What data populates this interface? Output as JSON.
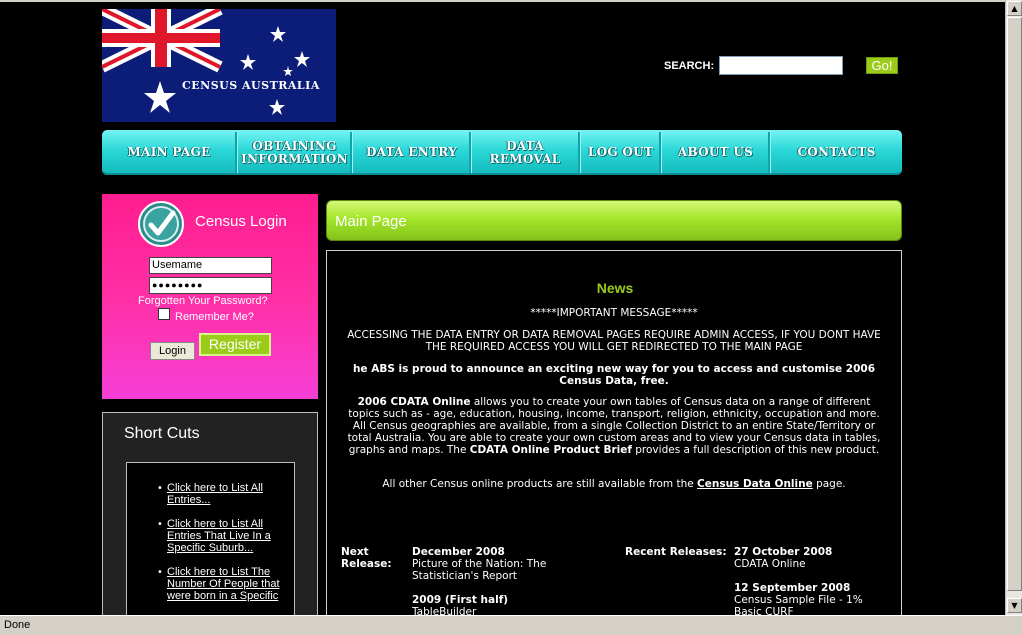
{
  "logo": {
    "text": "CENSUS AUSTRALIA"
  },
  "search": {
    "label": "SEARCH:",
    "value": "",
    "button": "Go!"
  },
  "nav": {
    "items": [
      "MAIN PAGE",
      "OBTAINING INFORMATION",
      "DATA ENTRY",
      "DATA REMOVAL",
      "LOG OUT",
      "ABOUT US",
      "CONTACTS"
    ]
  },
  "login": {
    "title": "Census Login",
    "username_value": "Usemame",
    "password_value": "●●●●●●●●",
    "forgot": "Forgotten Your Password?",
    "remember": "Remember Me?",
    "login_button": "Login",
    "register_button": "Register"
  },
  "shortcuts": {
    "title": "Short Cuts",
    "items": [
      "Click here to List All Entries...",
      "Click here to List All Entries That Live In a Specific Suburb...",
      "Click here to List The Number Of People that were born in a Specific"
    ]
  },
  "main": {
    "header": "Main Page",
    "news_title": "News",
    "important": "*****IMPORTANT MESSAGE*****",
    "admin_notice": "ACCESSING THE DATA ENTRY OR DATA REMOVAL PAGES REQUIRE ADMIN ACCESS, IF YOU DONT HAVE THE REQUIRED ACCESS YOU WILL GET REDIRECTED TO THE MAIN PAGE",
    "announce": "he ABS is proud to announce an exciting new way for you to access and customise 2006 Census Data, free.",
    "cdata_name": "2006 CDATA Online",
    "cdata_text": " allows you to create your own tables of Census data on a range of different topics such as - age, education, housing, income, transport, religion, ethnicity, occupation and more. All Census geographies are available, from a single Collection District to an entire State/Territory or total Australia. You are able to create your own custom areas and to view your Census data in tables, graphs and maps. The ",
    "cdata_brief": "CDATA Online Product Brief",
    "cdata_text2": " provides a full description of this new product.",
    "other_pre": "All other Census online products are still available from the ",
    "other_link": "Census Data Online",
    "other_post": " page.",
    "next_release_label": "Next Release:",
    "next_release_1_date": "December 2008",
    "next_release_1_text": "Picture of the Nation: The Statistician's Report",
    "next_release_2_date": "2009 (First half)",
    "next_release_2_text": "TableBuilder",
    "recent_label": "Recent Releases:",
    "recent_1_date": "27 October 2008",
    "recent_1_text": "CDATA Online",
    "recent_2_date": "12 September 2008",
    "recent_2_text": "Census Sample File - 1% Basic CURF"
  },
  "statusbar": {
    "text": "Done"
  },
  "colors": {
    "accent_green": "#9ccc1a",
    "nav_cyan": "#2bd7d7",
    "login_pink": "#ff2fa5",
    "flag_blue": "#0b1d78"
  }
}
